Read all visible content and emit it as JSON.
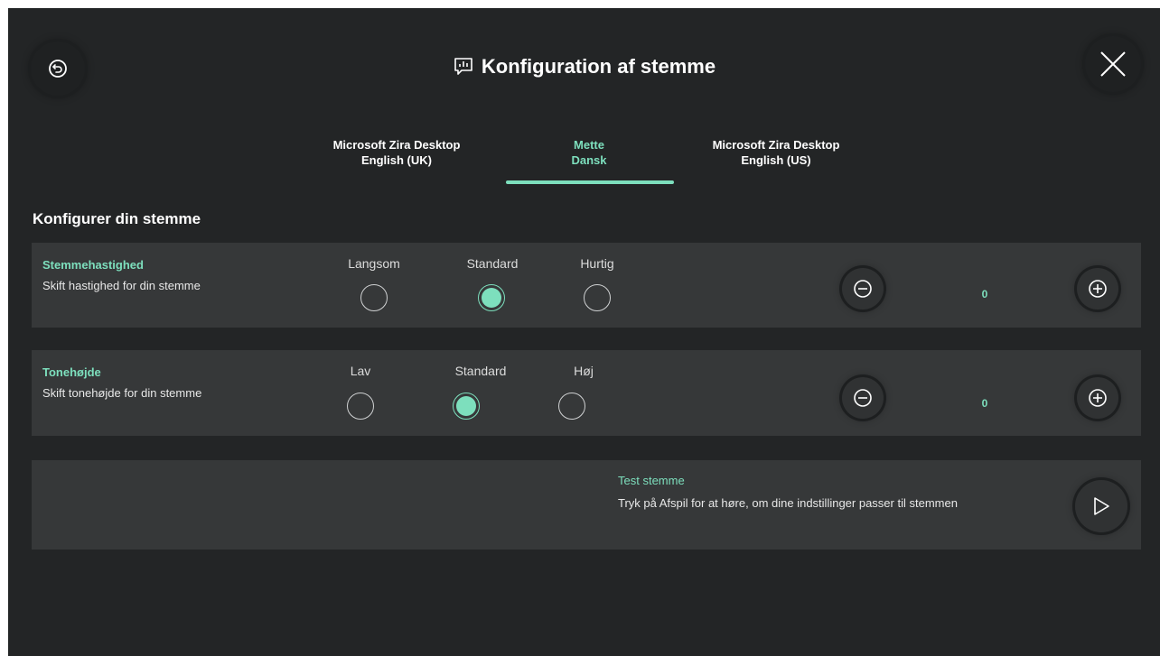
{
  "header": {
    "title": "Konfiguration af stemme",
    "title_icon": "speech-bubble-chart-icon",
    "back_icon": "undo-icon",
    "close_icon": "close-icon"
  },
  "voice_tabs": [
    {
      "line1": "Microsoft Zira Desktop",
      "line2": "English (UK)",
      "active": false
    },
    {
      "line1": "Mette",
      "line2": "Dansk",
      "active": true
    },
    {
      "line1": "Microsoft Zira Desktop",
      "line2": "English (US)",
      "active": false
    }
  ],
  "section_heading": "Konfigurer din stemme",
  "speed": {
    "label": "Stemmehastighed",
    "description": "Skift hastighed for din stemme",
    "options": [
      "Langsom",
      "Standard",
      "Hurtig"
    ],
    "selected": "Standard",
    "value": "0"
  },
  "pitch": {
    "label": "Tonehøjde",
    "description": "Skift tonehøjde for din stemme",
    "options": [
      "Lav",
      "Standard",
      "Høj"
    ],
    "selected": "Standard",
    "value": "0"
  },
  "test": {
    "label": "Test stemme",
    "description": "Tryk på Afspil for at høre, om dine indstillinger passer til stemmen",
    "play_icon": "play-icon"
  },
  "colors": {
    "background": "#232526",
    "card": "#363839",
    "accent": "#7ddfbd"
  }
}
